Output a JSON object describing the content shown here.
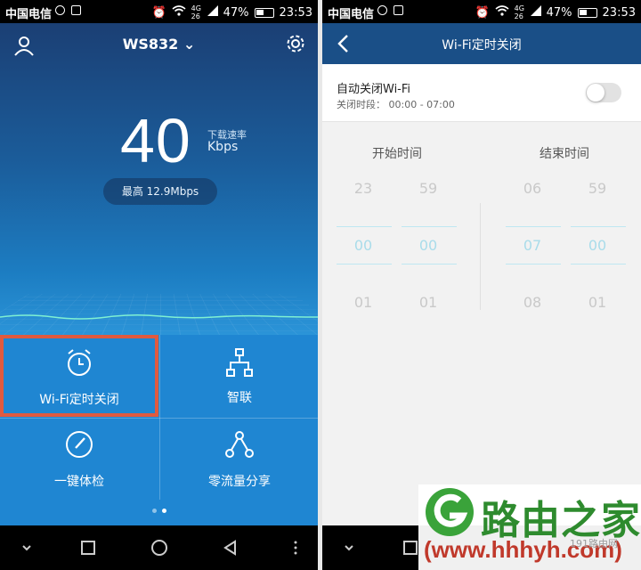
{
  "left": {
    "status": {
      "carrier": "中国电信",
      "battery": "47%",
      "time": "23:53",
      "net": "4G 26"
    },
    "network_name": "WS832",
    "speed": {
      "value": "40",
      "label": "下载速率",
      "unit": "Kbps",
      "peak": "最高 12.9Mbps"
    },
    "tiles": [
      {
        "label": "Wi-Fi定时关闭",
        "icon": "alarm-clock-icon"
      },
      {
        "label": "智联",
        "icon": "network-tree-icon"
      },
      {
        "label": "一键体检",
        "icon": "gauge-icon"
      },
      {
        "label": "零流量分享",
        "icon": "share-icon"
      }
    ],
    "page_dots": 2
  },
  "right": {
    "status": {
      "carrier": "中国电信",
      "battery": "47%",
      "time": "23:53",
      "net": "4G 26"
    },
    "title": "Wi-Fi定时关闭",
    "auto_off_label": "自动关闭Wi-Fi",
    "period_label": "关闭时段：  00:00 - 07:00",
    "toggle_on": false,
    "start_time_label": "开始时间",
    "end_time_label": "结束时间",
    "start_hours": [
      "23",
      "00",
      "01"
    ],
    "start_minutes": [
      "59",
      "00",
      "01"
    ],
    "end_hours": [
      "06",
      "07",
      "08"
    ],
    "end_minutes": [
      "59",
      "00",
      "01"
    ]
  },
  "watermark": {
    "title": "路由之家",
    "url": "(www.hhhyh.com)",
    "small": "191路由网"
  },
  "colors": {
    "accent": "#1f86d2",
    "header": "#1a4f87",
    "highlight_border": "#e05a3f",
    "selected_text": "#a9dcea"
  }
}
